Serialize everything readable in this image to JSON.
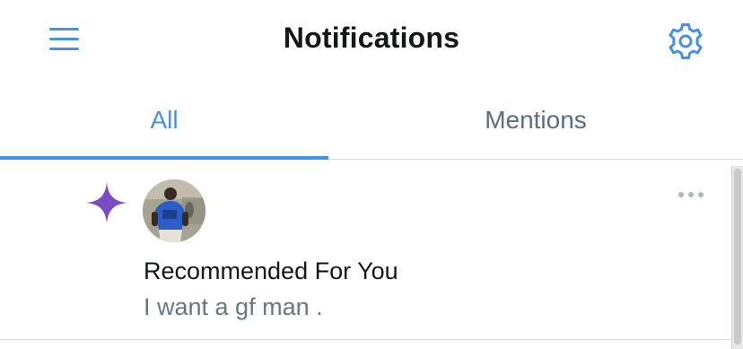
{
  "header": {
    "title": "Notifications",
    "menu_icon": "hamburger-menu-icon",
    "settings_icon": "gear-icon"
  },
  "tabs": [
    {
      "label": "All",
      "active": true
    },
    {
      "label": "Mentions",
      "active": false
    }
  ],
  "notifications": [
    {
      "type_icon": "sparkle-icon",
      "avatar": "user-avatar",
      "title": "Recommended For You",
      "body": "I want a gf man .",
      "more_icon": "more-options-icon"
    }
  ],
  "colors": {
    "accent": "#4a90e2",
    "sparkle": "#794bc4",
    "text_primary": "#14171a",
    "text_secondary": "#657786",
    "divider": "#dcdfe2"
  }
}
